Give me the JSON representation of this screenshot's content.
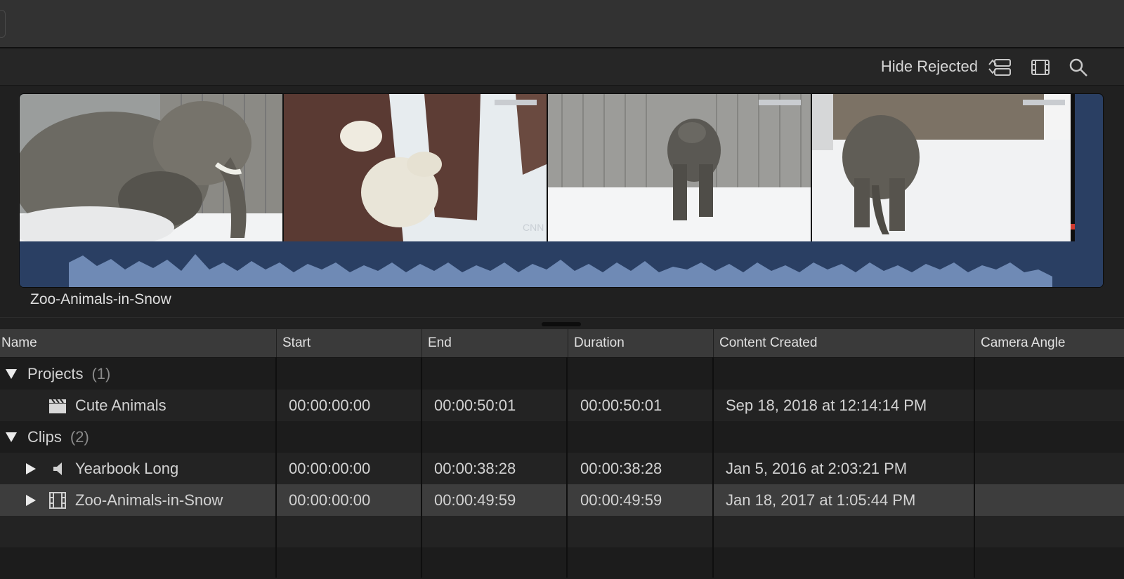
{
  "toolbar": {
    "filter_label": "Hide Rejected",
    "icons": [
      "sort-chevrons-icon",
      "list-view-icon",
      "filmstrip-icon",
      "search-icon"
    ]
  },
  "clip": {
    "name": "Zoo-Animals-in-Snow",
    "frames": [
      "elephant-closeup",
      "polar-bear-in-snow",
      "elephant-trumpeting",
      "elephant-walking"
    ],
    "waveform_color": "#6f8ab5",
    "clip_color": "#2a3f63"
  },
  "table": {
    "columns": [
      "Name",
      "Start",
      "End",
      "Duration",
      "Content Created",
      "Camera Angle"
    ],
    "groups": [
      {
        "label": "Projects",
        "count": "(1)",
        "expanded": true,
        "items": [
          {
            "name": "Cute Animals",
            "icon": "clapperboard-icon",
            "start": "00:00:00:00",
            "end": "00:00:50:01",
            "duration": "00:00:50:01",
            "created": "Sep 18, 2018 at 12:14:14 PM",
            "angle": "",
            "selected": false
          }
        ]
      },
      {
        "label": "Clips",
        "count": "(2)",
        "expanded": true,
        "items": [
          {
            "name": "Yearbook Long",
            "icon": "speaker-icon",
            "start": "00:00:00:00",
            "end": "00:00:38:28",
            "duration": "00:00:38:28",
            "created": "Jan 5, 2016 at 2:03:21 PM",
            "angle": "",
            "selected": false
          },
          {
            "name": "Zoo-Animals-in-Snow",
            "icon": "film-icon",
            "start": "00:00:00:00",
            "end": "00:00:49:59",
            "duration": "00:00:49:59",
            "created": "Jan 18, 2017 at 1:05:44 PM",
            "angle": "",
            "selected": true
          }
        ]
      }
    ]
  }
}
